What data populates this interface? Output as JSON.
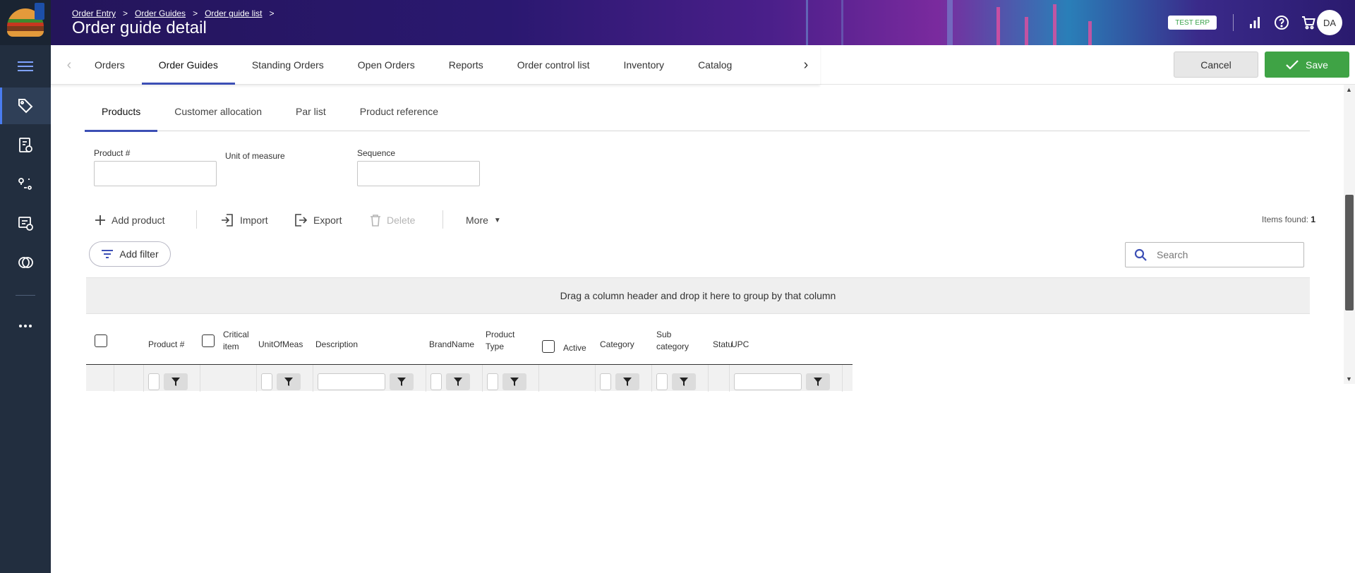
{
  "breadcrumb": [
    "Order Entry",
    "Order Guides",
    "Order guide list"
  ],
  "page_title": "Order guide detail",
  "env_badge": "TEST ERP",
  "avatar_initials": "DA",
  "top_tabs": [
    "Orders",
    "Order Guides",
    "Standing Orders",
    "Open Orders",
    "Reports",
    "Order control list",
    "Inventory",
    "Catalog"
  ],
  "actions": {
    "cancel": "Cancel",
    "save": "Save"
  },
  "sub_tabs": [
    "Products",
    "Customer allocation",
    "Par list",
    "Product reference"
  ],
  "fields": {
    "product": "Product #",
    "uom": "Unit of measure",
    "sequence": "Sequence"
  },
  "toolbar": {
    "add_product": "Add product",
    "import": "Import",
    "export": "Export",
    "delete": "Delete",
    "more": "More",
    "items_found_label": "Items found:",
    "items_found_count": "1"
  },
  "filter": {
    "add_filter": "Add filter",
    "search_placeholder": "Search"
  },
  "group_panel": "Drag a column header and drop it here to group by that column",
  "columns": {
    "product_no": "Product #",
    "critical_item_1": "Critical",
    "critical_item_2": "item",
    "uom": "UnitOfMeas",
    "description": "Description",
    "brand": "BrandName",
    "product_type_1": "Product",
    "product_type_2": "Type",
    "active": "Active",
    "category": "Category",
    "subcategory_1": "Sub",
    "subcategory_2": "category",
    "status": "Statu",
    "upc": "UPC"
  },
  "colors": {
    "accent": "#3c4fb5",
    "save": "#3fa345",
    "rail": "#222e3f"
  }
}
